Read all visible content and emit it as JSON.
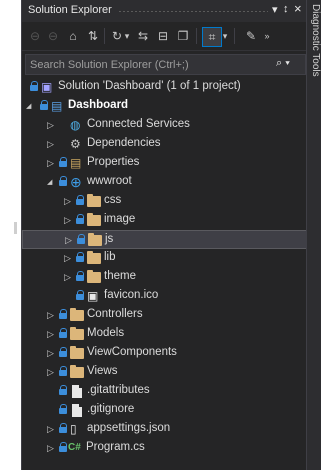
{
  "window": {
    "title": "Solution Explorer",
    "pin": "↕",
    "close": "×",
    "menu": "▾"
  },
  "side_panel": {
    "tab_label": "Diagnostic Tools"
  },
  "toolbar": {
    "tools": [
      "back",
      "forward",
      "home",
      "switch-views",
      "history",
      "sync",
      "collapse-all",
      "show-all-files",
      "preview",
      "properties",
      "overflow"
    ]
  },
  "search": {
    "placeholder": "Search Solution Explorer (Ctrl+;)",
    "button": "⌕ ▾"
  },
  "tree": [
    {
      "label": "Solution 'Dashboard' (1 of 1 project)",
      "level": 0,
      "icon": "solution-icon",
      "lock": true
    },
    {
      "label": "Dashboard",
      "level": 1,
      "icon": "project-icon",
      "lock": true,
      "bold": true,
      "expanded": true
    },
    {
      "label": "Connected Services",
      "level": 2,
      "icon": "connected-services-icon",
      "lock": false,
      "expand": "collapsed"
    },
    {
      "label": "Dependencies",
      "level": 2,
      "icon": "dependencies-icon",
      "lock": false,
      "expand": "collapsed"
    },
    {
      "label": "Properties",
      "level": 2,
      "icon": "properties-icon",
      "lock": true,
      "expand": "collapsed"
    },
    {
      "label": "wwwroot",
      "level": 2,
      "icon": "globe-icon",
      "lock": true,
      "expand": "expanded"
    },
    {
      "label": "css",
      "level": 3,
      "icon": "folder-icon",
      "lock": true,
      "expand": "collapsed"
    },
    {
      "label": "image",
      "level": 3,
      "icon": "folder-icon",
      "lock": true,
      "expand": "collapsed"
    },
    {
      "label": "js",
      "level": 3,
      "icon": "folder-icon",
      "lock": true,
      "expand": "collapsed",
      "selected": true
    },
    {
      "label": "lib",
      "level": 3,
      "icon": "folder-icon",
      "lock": true,
      "expand": "collapsed"
    },
    {
      "label": "theme",
      "level": 3,
      "icon": "folder-icon",
      "lock": true,
      "expand": "collapsed"
    },
    {
      "label": "favicon.ico",
      "level": 3,
      "icon": "image-file-icon",
      "lock": true
    },
    {
      "label": "Controllers",
      "level": 2,
      "icon": "folder-icon",
      "lock": true,
      "expand": "collapsed"
    },
    {
      "label": "Models",
      "level": 2,
      "icon": "folder-icon",
      "lock": true,
      "expand": "collapsed"
    },
    {
      "label": "ViewComponents",
      "level": 2,
      "icon": "folder-icon",
      "lock": true,
      "expand": "collapsed"
    },
    {
      "label": "Views",
      "level": 2,
      "icon": "folder-icon",
      "lock": true,
      "expand": "collapsed"
    },
    {
      "label": ".gitattributes",
      "level": 2,
      "icon": "file-icon",
      "lock": true
    },
    {
      "label": ".gitignore",
      "level": 2,
      "icon": "file-icon",
      "lock": true
    },
    {
      "label": "appsettings.json",
      "level": 2,
      "icon": "json-file-icon",
      "lock": true,
      "expand": "collapsed"
    },
    {
      "label": "Program.cs",
      "level": 2,
      "icon": "csharp-file-icon",
      "lock": true,
      "expand": "collapsed",
      "prefix": "C#"
    }
  ]
}
